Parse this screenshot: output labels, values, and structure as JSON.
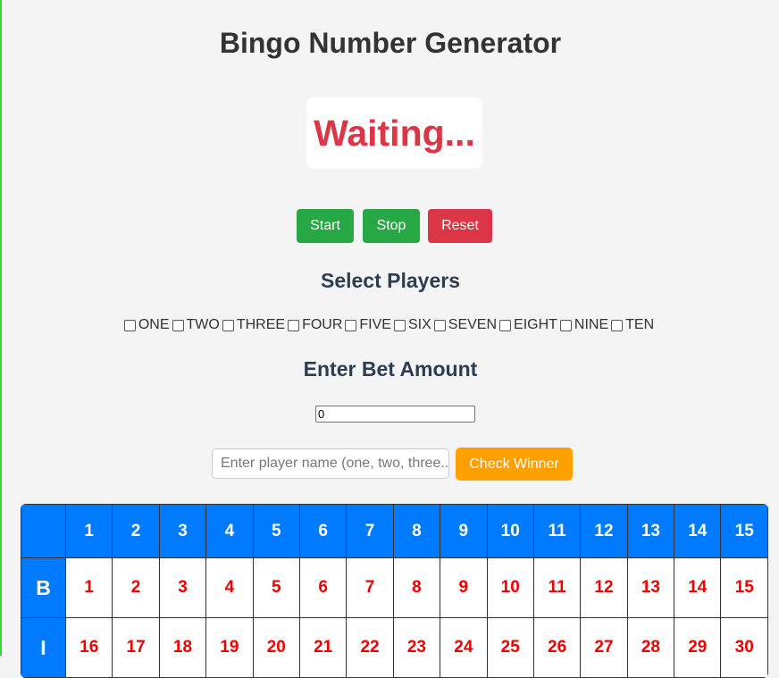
{
  "page": {
    "title": "Bingo Number Generator"
  },
  "display": {
    "status": "Waiting..."
  },
  "controls": {
    "start_label": "Start",
    "stop_label": "Stop",
    "reset_label": "Reset"
  },
  "players_section": {
    "title": "Select Players",
    "players": [
      "ONE",
      "TWO",
      "THREE",
      "FOUR",
      "FIVE",
      "SIX",
      "SEVEN",
      "EIGHT",
      "NINE",
      "TEN"
    ]
  },
  "bet_section": {
    "title": "Enter Bet Amount",
    "value": "0"
  },
  "winner_check": {
    "placeholder": "Enter player name (one, two, three...",
    "button_label": "Check Winner"
  },
  "board": {
    "column_headers": [
      "1",
      "2",
      "3",
      "4",
      "5",
      "6",
      "7",
      "8",
      "9",
      "10",
      "11",
      "12",
      "13",
      "14",
      "15"
    ],
    "rows": [
      {
        "letter": "B",
        "numbers": [
          "1",
          "2",
          "3",
          "4",
          "5",
          "6",
          "7",
          "8",
          "9",
          "10",
          "11",
          "12",
          "13",
          "14",
          "15"
        ]
      },
      {
        "letter": "I",
        "numbers": [
          "16",
          "17",
          "18",
          "19",
          "20",
          "21",
          "22",
          "23",
          "24",
          "25",
          "26",
          "27",
          "28",
          "29",
          "30"
        ]
      }
    ]
  },
  "colors": {
    "accent_blue": "#007bff",
    "green": "#28a745",
    "red": "#dc3545",
    "orange": "#ffa000",
    "number_red": "#ee0000"
  }
}
